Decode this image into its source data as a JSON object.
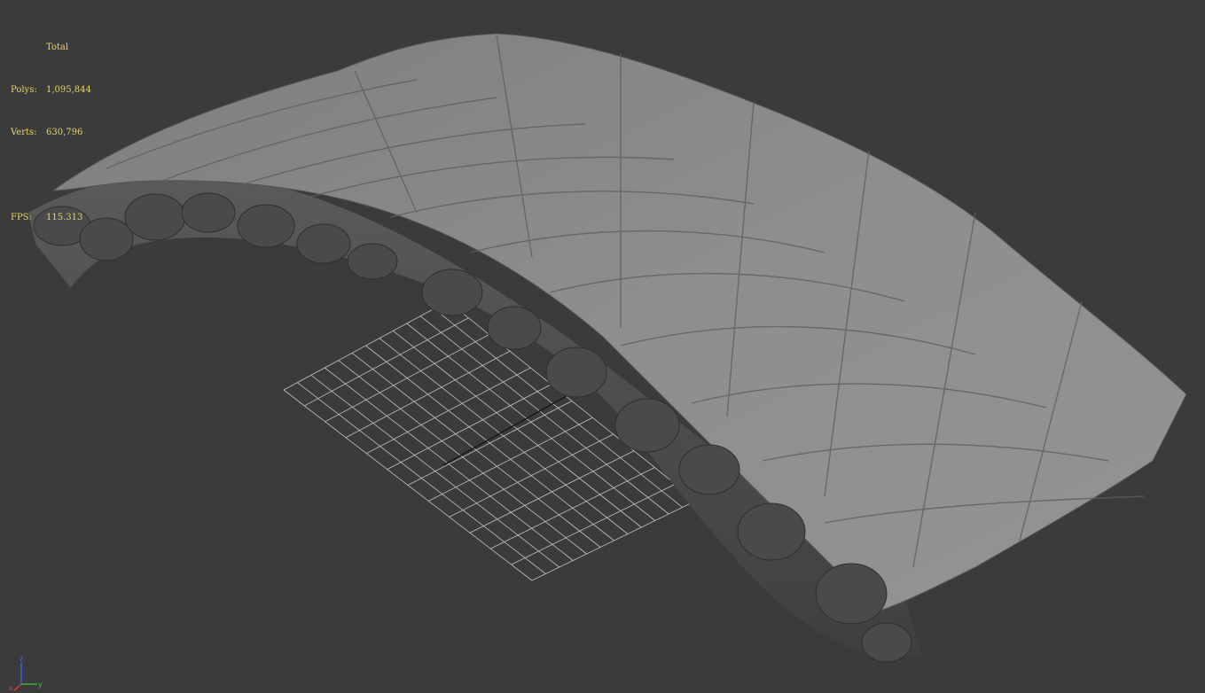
{
  "stats": {
    "title": "Total",
    "polys_label": "Polys:",
    "polys_value": "1,095,844",
    "verts_label": "Verts:",
    "verts_value": "630,796",
    "fps_label": "FPS:",
    "fps_value": "115.313"
  },
  "gizmo": {
    "z": "z",
    "x": "x",
    "y": "y"
  },
  "colors": {
    "viewport_bg": "#3b3b3b",
    "stats_text": "#e8d46a",
    "grid": "#d9d9d9",
    "stone_light": "#8a8a8a",
    "stone_dark": "#4e4e4e"
  }
}
